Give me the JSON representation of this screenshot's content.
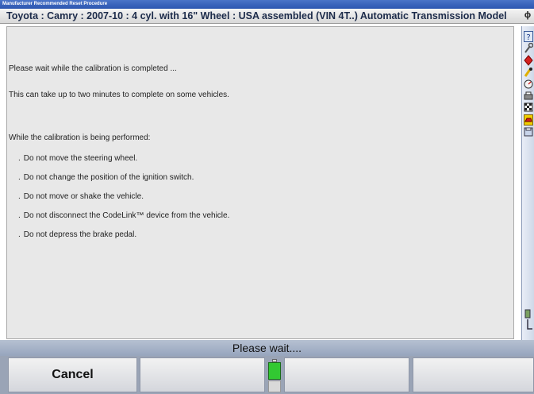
{
  "window": {
    "title": "Manufacturer Recommended Reset Procedure",
    "vehicle": "Toyota : Camry : 2007-10 : 4 cyl. with 16\" Wheel : USA assembled (VIN 4T..) Automatic Transmission Model",
    "vehicle_icon": "ϕ"
  },
  "content": {
    "line1": "Please wait while the calibration is completed ...",
    "line2": "This can take up to two minutes to complete on some vehicles.",
    "heading": "While the calibration is being performed:",
    "bullets": [
      "Do not move the steering wheel.",
      "Do not change the position of the ignition switch.",
      "Do not move or shake the vehicle.",
      "Do not disconnect the CodeLink™ device from the vehicle.",
      "Do not depress the brake pedal."
    ]
  },
  "status": {
    "prompt": "Please wait...."
  },
  "buttons": {
    "cancel": "Cancel"
  },
  "colors": {
    "title_bar": "#2c56b0",
    "content_bg": "#e8e8e8",
    "indicator_green": "#32c832"
  },
  "right_toolbar": [
    "help-icon",
    "wrench-icon",
    "red-diamond-icon",
    "yellow-tool-icon",
    "gauge-icon",
    "printer-icon",
    "checkered-flag-icon",
    "car-icon",
    "save-icon",
    "connector-icon"
  ]
}
